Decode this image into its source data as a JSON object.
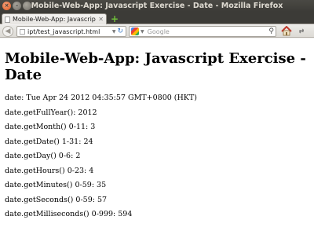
{
  "window": {
    "title": "Mobile-Web-App: Javascript Exercise - Date - Mozilla Firefox"
  },
  "tabs": [
    {
      "label": "Mobile-Web-App: Javascript E..."
    }
  ],
  "navbar": {
    "url": "ipt/test_javascript.html",
    "search_placeholder": "Google"
  },
  "page": {
    "heading": "Mobile-Web-App: Javascript Exercise - Date",
    "lines": [
      "date: Tue Apr 24 2012 04:35:57 GMT+0800 (HKT)",
      "date.getFullYear(): 2012",
      "date.getMonth() 0-11: 3",
      "date.getDate() 1-31: 24",
      "date.getDay() 0-6: 2",
      "date.getHours() 0-23: 4",
      "date.getMinutes() 0-59: 35",
      "date.getSeconds() 0-59: 57",
      "date.getMilliseconds() 0-999: 594"
    ]
  }
}
